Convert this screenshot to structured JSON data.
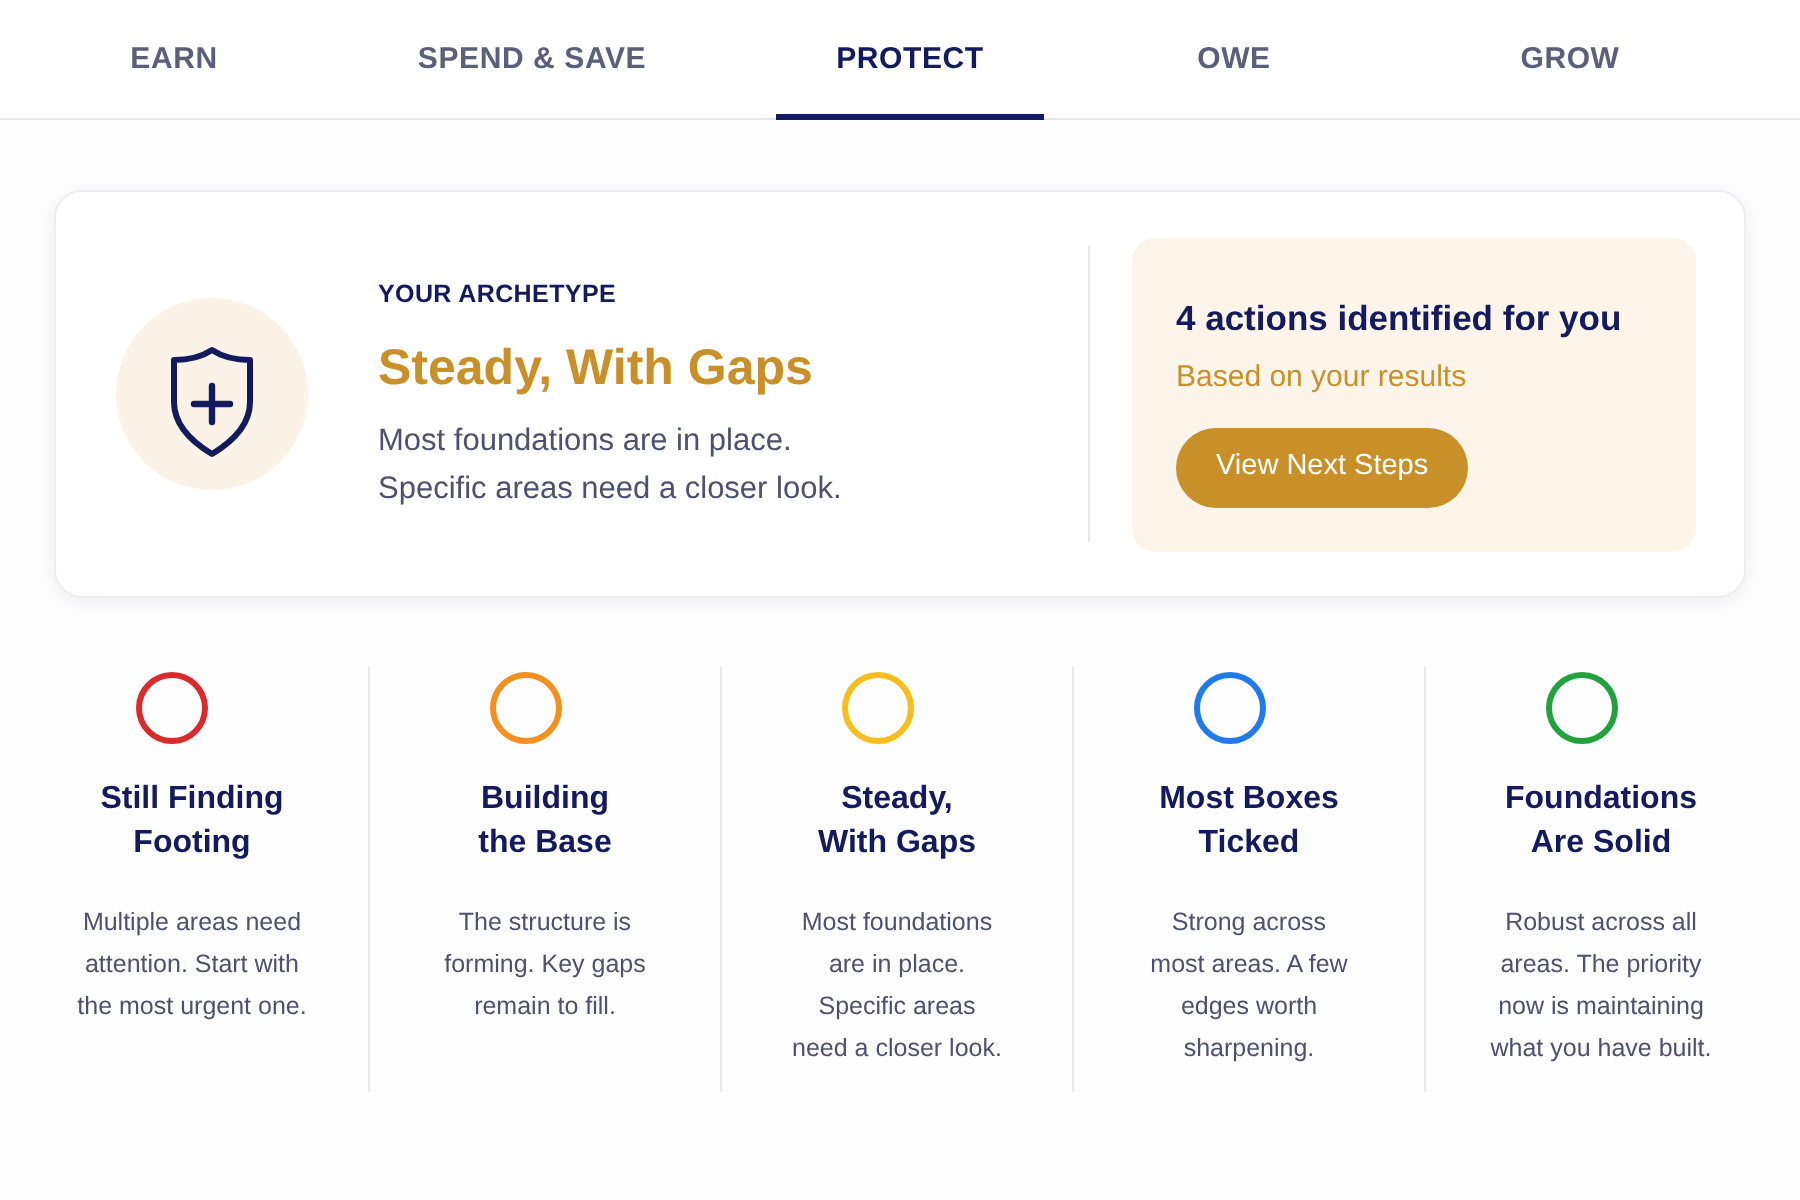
{
  "tabs": [
    {
      "label": "EARN",
      "selected": false
    },
    {
      "label": "SPEND & SAVE",
      "selected": false
    },
    {
      "label": "PROTECT",
      "selected": true
    },
    {
      "label": "OWE",
      "selected": false
    },
    {
      "label": "GROW",
      "selected": false
    }
  ],
  "archetype_card": {
    "eyebrow": "YOUR ARCHETYPE",
    "title": "Steady, With Gaps",
    "description": "Most foundations are in place.\nSpecific areas need a closer look.",
    "actions_panel": {
      "heading": "4 actions identified for you",
      "subheading": "Based on your results",
      "button": "View Next Steps"
    }
  },
  "archetypes": [
    {
      "title": "Still Finding\nFooting",
      "description": "Multiple areas need\nattention. Start with\nthe most urgent one.",
      "color": "#d92b2b"
    },
    {
      "title": "Building\nthe Base",
      "description": "The structure is\nforming. Key gaps\nremain to fill.",
      "color": "#f58f1e"
    },
    {
      "title": "Steady,\nWith Gaps",
      "description": "Most foundations\nare in place.\nSpecific areas\nneed a closer look.",
      "color": "#f6be1d"
    },
    {
      "title": "Most Boxes\nTicked",
      "description": "Strong across\nmost areas. A few\nedges worth\nsharpening.",
      "color": "#1f7aec"
    },
    {
      "title": "Foundations\nAre Solid",
      "description": "Robust across all\nareas. The priority\nnow is maintaining\nwhat you have built.",
      "color": "#22a23e"
    }
  ]
}
